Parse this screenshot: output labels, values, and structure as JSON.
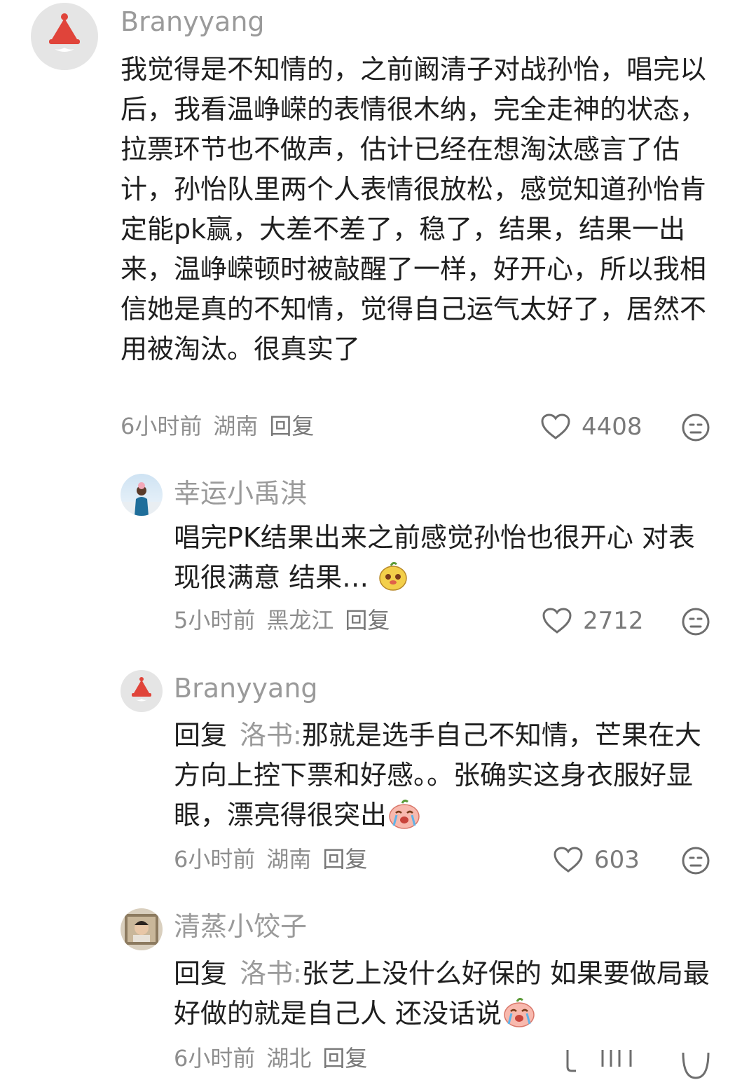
{
  "comments": [
    {
      "username": "Branyyang",
      "content": "我觉得是不知情的，之前阚清子对战孙怡，唱完以后，我看温峥嵘的表情很木纳，完全走神的状态，拉票环节也不做声，估计已经在想淘汰感言了估计，孙怡队里两个人表情很放松，感觉知道孙怡肯定能pk赢，大差不差了，稳了，结果，结果一出来，温峥嵘顿时被敲醒了一样，好开心，所以我相信她是真的不知情，觉得自己运气太好了，居然不用被淘汰。很真实了",
      "time": "6小时前",
      "location": "湖南",
      "reply_label": "回复",
      "likes": "4408",
      "avatar_icon": "santa-hat-icon"
    },
    {
      "username": "幸运小禹淇",
      "content": "唱完PK结果出来之前感觉孙怡也很开心 对表现很满意 结果…",
      "emoji": "mango-face-emoji",
      "time": "5小时前",
      "location": "黑龙江",
      "reply_label": "回复",
      "likes": "2712",
      "avatar_icon": "photo-avatar"
    },
    {
      "username": "Branyyang",
      "reply_prefix": "回复",
      "reply_to": "洛书:",
      "content": "那就是选手自己不知情，芒果在大方向上控下票和好感。。张确实这身衣服好显眼，漂亮得很突出",
      "emoji": "crying-mango-emoji",
      "time": "6小时前",
      "location": "湖南",
      "reply_label": "回复",
      "likes": "603",
      "avatar_icon": "santa-hat-icon"
    },
    {
      "username": "清蒸小饺子",
      "reply_prefix": "回复",
      "reply_to": "洛书:",
      "content": "张艺上没什么好保的 如果要做局最好做的就是自己人 还没话说",
      "emoji": "crying-mango-emoji",
      "time": "6小时前",
      "location": "湖北",
      "reply_label": "回复",
      "avatar_icon": "photo-avatar"
    }
  ],
  "colors": {
    "username": "#9a9a9a",
    "text": "#1f1f1f",
    "meta": "#8e8e8e",
    "santa_red": "#e0443a",
    "avatar_bg": "#e6e6e6"
  }
}
